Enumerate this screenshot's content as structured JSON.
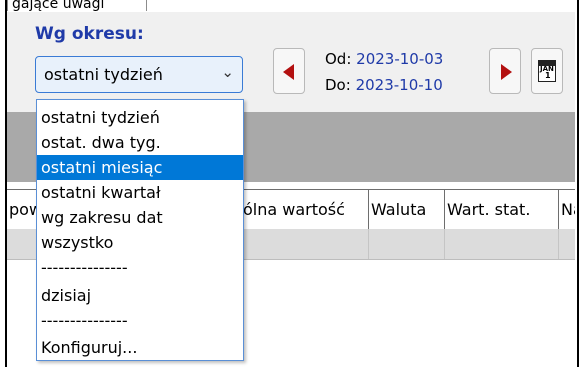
{
  "tab": {
    "label": "gające uwagi"
  },
  "filter": {
    "period_label": "Wg okresu:",
    "selected_value": "ostatni tydzień",
    "from_label": "Od:",
    "from_date": "2023-10-03",
    "to_label": "Do:",
    "to_date": "2023-10-10",
    "calendar_month": "JAN",
    "calendar_day": "1"
  },
  "dropdown": {
    "items": [
      "ostatni tydzień",
      "ostat. dwa tyg.",
      "ostatni miesiąc",
      "ostatni kwartał",
      "wg zakresu dat",
      "wszystko",
      "---------------",
      "dzisiaj",
      "---------------",
      "Konfiguruj..."
    ],
    "highlighted": "ostatni miesiąc"
  },
  "table": {
    "columns": [
      "pow",
      "",
      "ólna wartość",
      "Waluta",
      "Wart. stat.",
      "Na"
    ]
  },
  "colors": {
    "accent_blue": "#1f3aa8",
    "selection": "#0078d7",
    "arrow_red": "#b31010"
  }
}
